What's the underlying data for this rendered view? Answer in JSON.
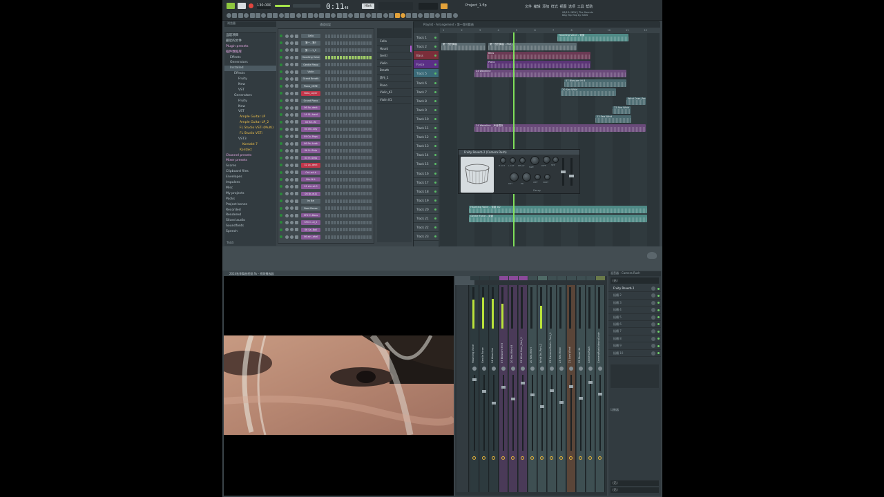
{
  "topbar": {
    "tempo": "130.000",
    "time": "0:11",
    "time_small": "48",
    "pattern": "Hint",
    "project_title": "Project_1.flp",
    "menu": [
      "文件",
      "编辑",
      "添加",
      "样式",
      "视图",
      "选项",
      "工具",
      "帮助"
    ],
    "news_line1": "06/13: NEW | The Sounds",
    "news_line2": "Bag Hip Hop by SIXIS"
  },
  "browser": {
    "title": "浏览器",
    "items": [
      {
        "label": "当前项目",
        "cls": "blu",
        "indent": 2
      },
      {
        "label": "最近的文件",
        "cls": "blu",
        "indent": 2
      },
      {
        "label": "Plugin presets",
        "cls": "hl",
        "indent": 2
      },
      {
        "label": "插件数据库",
        "cls": "hl",
        "indent": 2
      },
      {
        "label": "Effects",
        "cls": "",
        "indent": 8
      },
      {
        "label": "Generators",
        "cls": "",
        "indent": 8
      },
      {
        "label": "Installed",
        "cls": "sel",
        "indent": 8
      },
      {
        "label": "Effects",
        "cls": "",
        "indent": 14
      },
      {
        "label": "Fruity",
        "cls": "",
        "indent": 20
      },
      {
        "label": "New",
        "cls": "",
        "indent": 20
      },
      {
        "label": "VST",
        "cls": "",
        "indent": 20
      },
      {
        "label": "Generators",
        "cls": "",
        "indent": 14
      },
      {
        "label": "Fruity",
        "cls": "",
        "indent": 20
      },
      {
        "label": "New",
        "cls": "",
        "indent": 20
      },
      {
        "label": "VST",
        "cls": "",
        "indent": 20
      },
      {
        "label": "Ample Guitar LP",
        "cls": "yel",
        "indent": 22
      },
      {
        "label": "Ample Guitar LP_2",
        "cls": "yel",
        "indent": 22
      },
      {
        "label": "FL Studio VSTi (Multi)",
        "cls": "yel",
        "indent": 22
      },
      {
        "label": "FL Studio VSTi",
        "cls": "yel",
        "indent": 22
      },
      {
        "label": "VST3",
        "cls": "",
        "indent": 20
      },
      {
        "label": "Kontakt 7",
        "cls": "yel",
        "indent": 26
      },
      {
        "label": "Kontakt",
        "cls": "yel",
        "indent": 22
      },
      {
        "label": "Channel presets",
        "cls": "hl",
        "indent": 2
      },
      {
        "label": "Mixer presets",
        "cls": "hl",
        "indent": 2
      },
      {
        "label": "Scores",
        "cls": "",
        "indent": 2
      },
      {
        "label": "Clipboard files",
        "cls": "",
        "indent": 2
      },
      {
        "label": "Envelopes",
        "cls": "",
        "indent": 2
      },
      {
        "label": "Impulses",
        "cls": "",
        "indent": 2
      },
      {
        "label": "Misc",
        "cls": "",
        "indent": 2
      },
      {
        "label": "My projects",
        "cls": "",
        "indent": 2
      },
      {
        "label": "Packs",
        "cls": "",
        "indent": 2
      },
      {
        "label": "Project bones",
        "cls": "",
        "indent": 2
      },
      {
        "label": "Recorded",
        "cls": "",
        "indent": 2
      },
      {
        "label": "Rendered",
        "cls": "",
        "indent": 2
      },
      {
        "label": "Sliced audio",
        "cls": "",
        "indent": 2
      },
      {
        "label": "Soundfonts",
        "cls": "",
        "indent": 2
      },
      {
        "label": "Speech",
        "cls": "",
        "indent": 2
      }
    ],
    "footer": "TAGS"
  },
  "rack": {
    "title": "通道机架",
    "channels": [
      {
        "name": "Cello",
        "color": "#56636a"
      },
      {
        "name": "第一…第5",
        "color": "#56636a"
      },
      {
        "name": "第一…1_2",
        "color": "#56636a"
      },
      {
        "name": "Haunting Voice",
        "color": "#56636a"
      },
      {
        "name": "Gentle Piano",
        "color": "#56636a"
      },
      {
        "name": "Violin",
        "color": "#56636a"
      },
      {
        "name": "Grand Breath",
        "color": "#56636a"
      },
      {
        "name": "Piano_CERE",
        "color": "#56636a"
      },
      {
        "name": "Bass_Layer",
        "color": "#c1364a"
      },
      {
        "name": "Grand Piano",
        "color": "#56636a"
      },
      {
        "name": "06 Sa..dent",
        "color": "#8a5a9a"
      },
      {
        "name": "1A SL..hard",
        "color": "#8a5a9a"
      },
      {
        "name": "02 Be..ife",
        "color": "#8a5a9a"
      },
      {
        "name": "04 ein..aky",
        "color": "#8a5a9a"
      },
      {
        "name": "09 Ca..Pops",
        "color": "#8a5a9a"
      },
      {
        "name": "06 Sa..Leak",
        "color": "#8a5a9a"
      },
      {
        "name": "06 Fr..Strip",
        "color": "#8a5a9a"
      },
      {
        "name": "03 Fr..Strip",
        "color": "#8a5a9a"
      },
      {
        "name": "32 La..dent",
        "color": "#c1364a"
      },
      {
        "name": "Cat..ad-k",
        "color": "#8a5a9a"
      },
      {
        "name": "Blo..ft it",
        "color": "#8a5a9a"
      },
      {
        "name": "01 ein..al-0",
        "color": "#8a5a9a"
      },
      {
        "name": "06 Br..el-B",
        "color": "#8a5a9a"
      },
      {
        "name": "Im Bel",
        "color": "#56636a"
      },
      {
        "name": "Beat Bones",
        "color": "#56636a"
      },
      {
        "name": "SFX C..Bass",
        "color": "#8a5a9a"
      },
      {
        "name": "SFX C..el_2",
        "color": "#8a5a9a"
      },
      {
        "name": "06 Sa..Ball",
        "color": "#8a5a9a"
      },
      {
        "name": "06 ain..ahel",
        "color": "#8a5a9a"
      }
    ]
  },
  "tracklist": {
    "items": [
      "Cello",
      "Haunt",
      "Gentl",
      "Violin",
      "Breath",
      "第作_1",
      "Piano",
      "Violin_K1",
      "Violin K1"
    ]
  },
  "playlist": {
    "title": "Playlist - Arrangement › 第一首的舞曲",
    "tracks": [
      "Track 1",
      "Track 2",
      "Bass",
      "Force",
      "Track 5",
      "Track 6",
      "Track 7",
      "Track 8",
      "Track 9",
      "Track 10",
      "Track 11",
      "Track 12",
      "Track 13",
      "Track 14",
      "Track 15",
      "Track 16",
      "Track 17",
      "Track 18",
      "Track 19",
      "Track 20",
      "Track 21",
      "Track 22",
      "Track 23"
    ],
    "clips": [
      {
        "label": "Haunting Voice – 背景",
        "row": 0,
        "start": 170,
        "len": 103,
        "color": "#4f8a86"
      },
      {
        "label": "第一首的舞曲",
        "row": 1,
        "start": 2,
        "len": 64,
        "color": "#5a6a70"
      },
      {
        "label": "第一首的舞曲 - Part_2",
        "row": 1,
        "start": 70,
        "len": 128,
        "color": "#5a6a70"
      },
      {
        "label": "Bass",
        "row": 2,
        "start": 68,
        "len": 150,
        "color": "#6b3a54"
      },
      {
        "label": "Piano",
        "row": 3,
        "start": 68,
        "len": 150,
        "color": "#5b3576"
      },
      {
        "label": "24 Waveline",
        "row": 4,
        "start": 50,
        "len": 220,
        "color": "#6a4a7a"
      },
      {
        "label": "07 Blossom Hi 8",
        "row": 5,
        "start": 180,
        "len": 90,
        "color": "#4b6a70"
      },
      {
        "label": "20 Sea Whirl",
        "row": 6,
        "start": 175,
        "len": 80,
        "color": "#4b6a70"
      },
      {
        "label": "Wind Over_Part_2",
        "row": 7,
        "start": 270,
        "len": 28,
        "color": "#4b6a70"
      },
      {
        "label": "22 Sea Whirl",
        "row": 8,
        "start": 250,
        "len": 26,
        "color": "#4b6a70"
      },
      {
        "label": "23 Sea Wind",
        "row": 9,
        "start": 225,
        "len": 52,
        "color": "#4b6a70"
      },
      {
        "label": "24 Waveline – 声音模拟",
        "row": 10,
        "start": 50,
        "len": 248,
        "color": "#6a4a7a"
      },
      {
        "label": "Haunting Voice – 背景 #2",
        "row": 19,
        "start": 42,
        "len": 258,
        "color": "#4f8a86"
      },
      {
        "label": "Gentle Force – 背景",
        "row": 20,
        "start": 42,
        "len": 258,
        "color": "#4f8a86"
      }
    ],
    "ruler_marks": [
      "1",
      "2",
      "3",
      "4",
      "5",
      "6",
      "7",
      "8",
      "9",
      "10",
      "11",
      "12"
    ]
  },
  "plugin": {
    "title": "Fruity Reverb 2 (Camera Rush)",
    "preset": "Decay",
    "labels": [
      "H.CUT",
      "L.CUT",
      "DELAY",
      "SIZE",
      "DIFF",
      "SEP",
      "DRY",
      "ER",
      "WET",
      "SORT"
    ]
  },
  "video": {
    "title": "2024秋季舞曲视频.flv - 视频播放器"
  },
  "mixer": {
    "strips": [
      {
        "name": "Haunting Voice",
        "color": "#2d3a3e",
        "level": 0.7
      },
      {
        "name": "Gentle Force",
        "color": "#2d3a3e",
        "level": 0.75
      },
      {
        "name": "24 Waveline",
        "color": "#2d3a3e",
        "level": 0.72
      },
      {
        "name": "07 Blossom Hi 8",
        "color": "#4a3a58",
        "level": 0.6
      },
      {
        "name": "20 Sea Whirl 8",
        "color": "#4a3a58",
        "level": 0.0
      },
      {
        "name": "22 Wind Over_Part_2",
        "color": "#4a3a58",
        "level": 0.0
      },
      {
        "name": "20 Sea Whirl",
        "color": "#3e4f52",
        "level": 0.0
      },
      {
        "name": "Wind Ov..Part_2",
        "color": "#3e4f52",
        "level": 0.55
      },
      {
        "name": "05 Camera Rush - Part_2",
        "color": "#3e4f52",
        "level": 0.0
      },
      {
        "name": "23 Sea Wind",
        "color": "#3e4f52",
        "level": 0.0
      },
      {
        "name": "21 Lars Wind",
        "color": "#5a4538",
        "level": 0.0
      },
      {
        "name": "22 Stone Hit",
        "color": "#3e4f52",
        "level": 0.0
      },
      {
        "name": "Camera Rush",
        "color": "#3e4f52",
        "level": 0.0
      },
      {
        "name": "CameraRush NeuraControl Part_2",
        "color": "#3e4f52",
        "level": 0.0
      }
    ]
  },
  "slots": {
    "title": "混音器 - Camera Rush",
    "input": "(无)",
    "items": [
      "Fruity Reverb 2",
      "插槽 2",
      "插槽 3",
      "插槽 4",
      "插槽 5",
      "插槽 6",
      "插槽 7",
      "插槽 8",
      "插槽 9",
      "插槽 10"
    ],
    "eq_label": "均衡器",
    "out_label": "(无)",
    "out_label2": "(无)"
  }
}
